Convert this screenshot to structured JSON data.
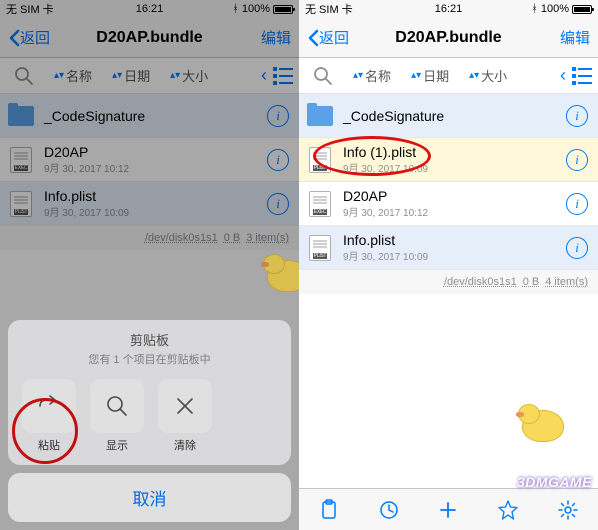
{
  "status": {
    "carrier": "无 SIM 卡",
    "wifi_icon": "wifi",
    "time": "16:21",
    "bt_icon": "bluetooth",
    "battery_pct": "100%"
  },
  "nav": {
    "back_label": "返回",
    "title": "D20AP.bundle",
    "edit_label": "编辑"
  },
  "sort": {
    "name_label": "名称",
    "date_label": "日期",
    "size_label": "大小"
  },
  "left_files": [
    {
      "name": "_CodeSignature",
      "date": "",
      "type": "folder"
    },
    {
      "name": "D20AP",
      "date": "9月 30, 2017 10:12",
      "type": "exec"
    },
    {
      "name": "Info.plist",
      "date": "9月 30, 2017 10:09",
      "type": "plist"
    }
  ],
  "right_files": [
    {
      "name": "_CodeSignature",
      "date": "",
      "type": "folder"
    },
    {
      "name": "Info (1).plist",
      "date": "9月 30, 2017 10:09",
      "type": "plist"
    },
    {
      "name": "D20AP",
      "date": "9月 30, 2017 10:12",
      "type": "exec"
    },
    {
      "name": "Info.plist",
      "date": "9月 30, 2017 10:09",
      "type": "plist"
    }
  ],
  "footer_left": {
    "disk": "/dev/disk0s1s1",
    "size": "0 B",
    "count": "3 item(s)"
  },
  "footer_right": {
    "disk": "/dev/disk0s1s1",
    "size": "0 B",
    "count": "4 item(s)"
  },
  "sheet": {
    "title": "剪贴板",
    "subtitle": "您有 1 个项目在剪贴板中",
    "paste_label": "粘贴",
    "show_label": "显示",
    "clear_label": "清除",
    "cancel_label": "取消"
  },
  "watermark": "3DMGAME"
}
